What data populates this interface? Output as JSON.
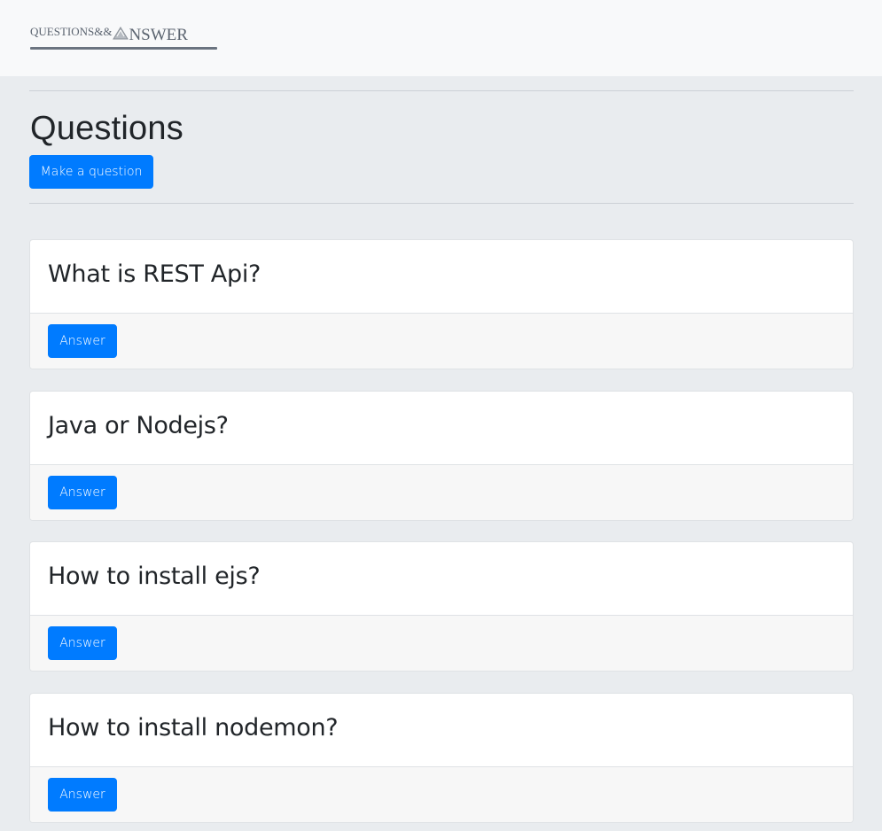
{
  "navbar": {
    "brand": {
      "part1": "QUESTIONS&&",
      "part2": "NSWER"
    }
  },
  "page": {
    "title": "Questions",
    "make_question_label": "Make a question"
  },
  "questions": [
    {
      "title": "What is REST Api?",
      "answer_label": "Answer"
    },
    {
      "title": "Java or Nodejs?",
      "answer_label": "Answer"
    },
    {
      "title": "How to install ejs?",
      "answer_label": "Answer"
    },
    {
      "title": "How to install nodemon?",
      "answer_label": "Answer"
    }
  ],
  "colors": {
    "primary": "#007bff",
    "navbar_bg": "#f8f9fa",
    "page_bg": "#e9ecef",
    "card_footer_bg": "#f7f7f7"
  }
}
